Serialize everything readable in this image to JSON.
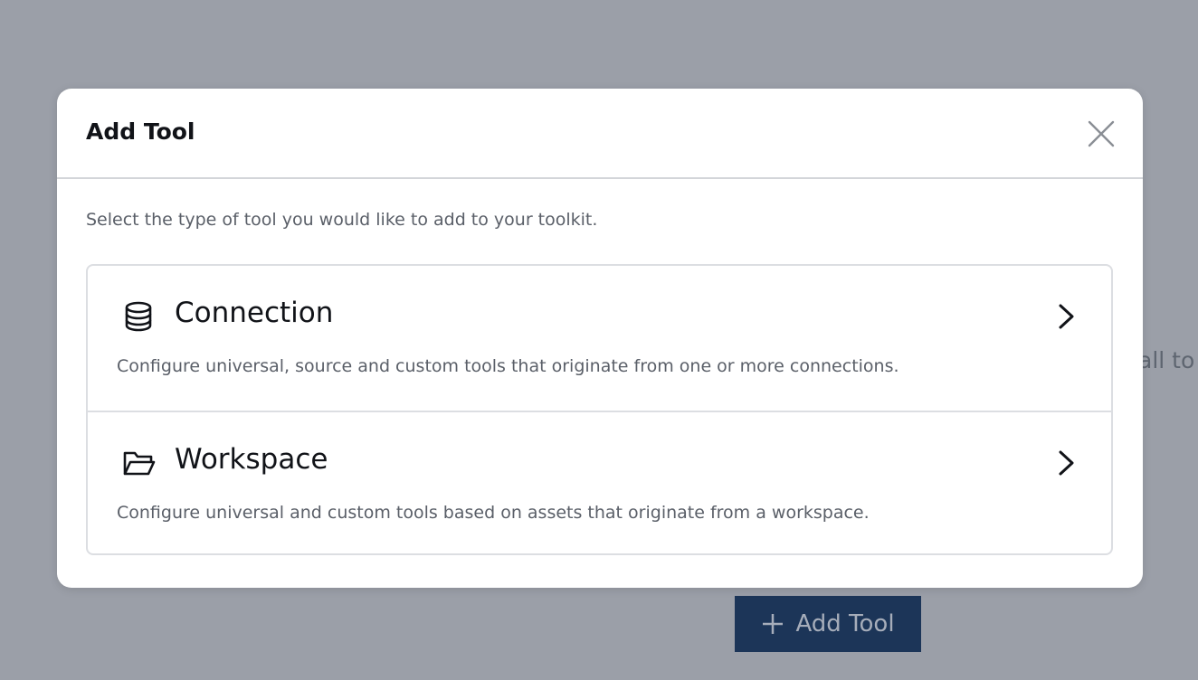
{
  "background": {
    "partial_text": "all to",
    "add_tool_button_label": "Add Tool",
    "button_color": "#1c3558"
  },
  "modal": {
    "title": "Add Tool",
    "description": "Select the type of tool you would like to add to your toolkit.",
    "options": [
      {
        "icon": "database-icon",
        "title": "Connection",
        "description": "Configure universal, source and custom tools that originate from one or more connections."
      },
      {
        "icon": "folder-open-icon",
        "title": "Workspace",
        "description": "Configure universal and custom tools based on assets that originate from a workspace."
      }
    ]
  }
}
